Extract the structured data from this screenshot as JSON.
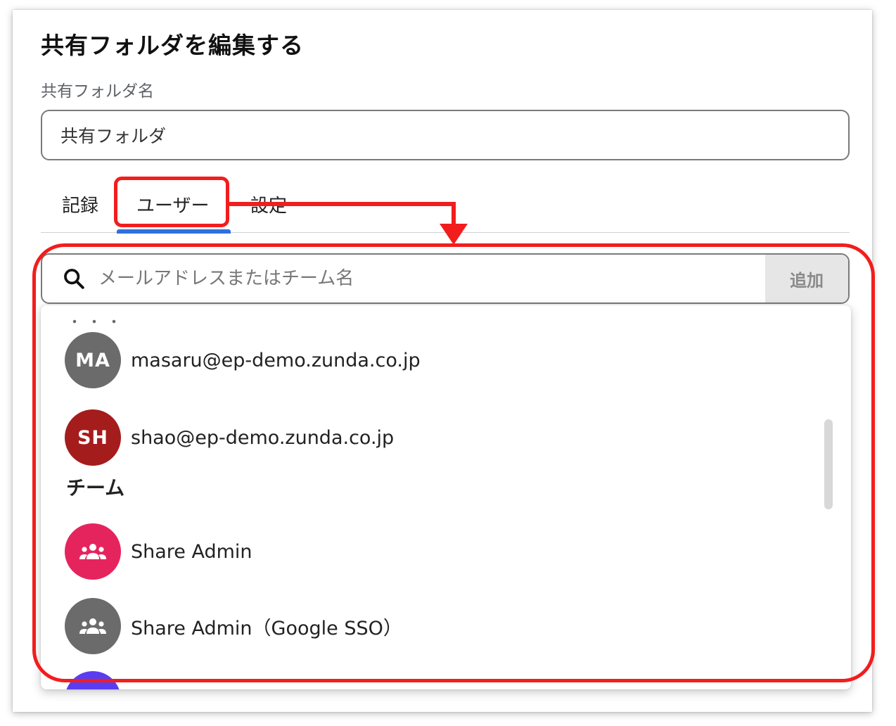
{
  "dialog": {
    "title": "共有フォルダを編集する",
    "name_label": "共有フォルダ名",
    "name_value": "共有フォルダ"
  },
  "tabs": [
    {
      "label": "記録"
    },
    {
      "label": "ユーザー",
      "selected": true
    },
    {
      "label": "設定"
    }
  ],
  "search": {
    "placeholder": "メールアドレスまたはチーム名",
    "add_label": "追加"
  },
  "dropdown": {
    "users": [
      {
        "initials": "MA",
        "email": "masaru@ep-demo.zunda.co.jp",
        "color": "#6b6b6b"
      },
      {
        "initials": "SH",
        "email": "shao@ep-demo.zunda.co.jp",
        "color": "#a51c1c"
      }
    ],
    "teams_header": "チーム",
    "teams": [
      {
        "name": "Share Admin",
        "icon": "team-icon",
        "color": "#e5245e"
      },
      {
        "name": "Share Admin（Google SSO）",
        "icon": "team-icon",
        "color": "#6b6b6b"
      },
      {
        "name": "",
        "icon": "team-icon",
        "color": "#5a3df0"
      }
    ]
  },
  "colors": {
    "annotation_red": "#f21d1d",
    "tab_accent": "#2f6fde"
  }
}
